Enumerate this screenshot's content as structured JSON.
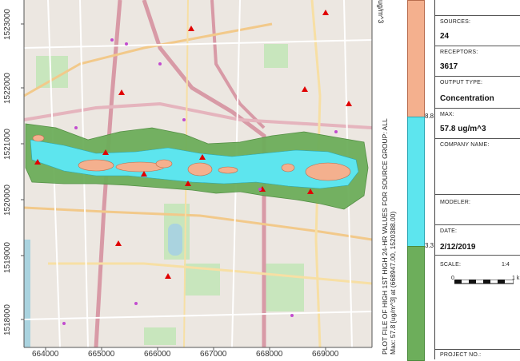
{
  "axes": {
    "y_labels": [
      "1523000",
      "1522000",
      "1521000",
      "1520000",
      "1519000",
      "1518000"
    ],
    "x_labels": [
      "664000",
      "665000",
      "666000",
      "667000",
      "668000",
      "669000"
    ]
  },
  "plot_title": "PLOT FILE OF HIGH 1ST HIGH 24-HR VALUES FOR SOURCE GROUP: ALL",
  "plot_subtitle": "Max: 57.8 [ug/m^3] at (668947.00, 1520388.00)",
  "legend": {
    "unit": "ug/m^3",
    "break_high": "8.8",
    "break_low": "3.3",
    "colors": {
      "high": "#f4b08e",
      "mid": "#5de5ee",
      "low": "#6dae5b"
    }
  },
  "panel": {
    "sources_label": "SOURCES:",
    "sources_value": "24",
    "receptors_label": "RECEPTORS:",
    "receptors_value": "3617",
    "output_type_label": "OUTPUT TYPE:",
    "output_type_value": "Concentration",
    "max_label": "MAX:",
    "max_value": "57.8 ug/m^3",
    "company_label": "COMPANY NAME:",
    "modeler_label": "MODELER:",
    "date_label": "DATE:",
    "date_value": "2/12/2019",
    "scale_label": "SCALE:",
    "scale_ratio": "1:4",
    "scale_start": "0",
    "scale_end": "1 k",
    "project_label": "PROJECT NO.:"
  }
}
